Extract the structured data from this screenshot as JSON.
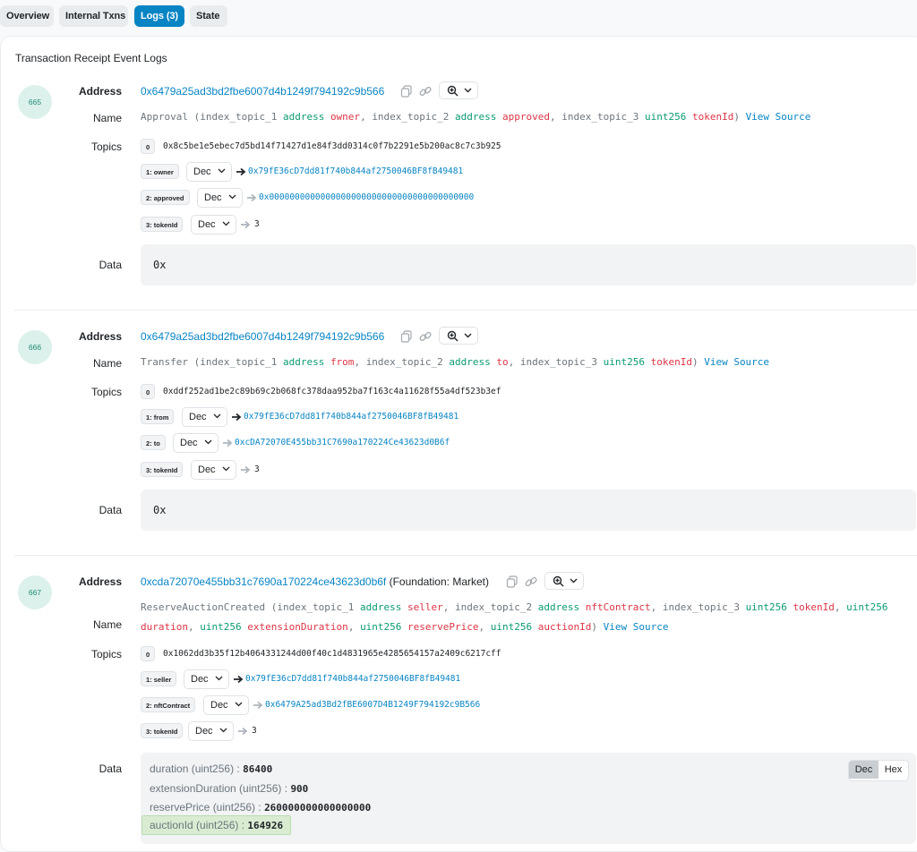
{
  "tabs": [
    {
      "label": "Overview",
      "active": false
    },
    {
      "label": "Internal Txns",
      "active": false
    },
    {
      "label": "Logs (3)",
      "active": true
    },
    {
      "label": "State",
      "active": false
    }
  ],
  "section_title": "Transaction Receipt Event Logs",
  "labels": {
    "address": "Address",
    "name": "Name",
    "topics": "Topics",
    "data": "Data"
  },
  "view_source": "View Source",
  "logs": [
    {
      "index": "665",
      "address": "0x6479a25ad3bd2fbe6007d4b1249f794192c9b566",
      "event": "Approval",
      "params": [
        {
          "topic": "index_topic_1",
          "type": "address",
          "name": "owner"
        },
        {
          "topic": "index_topic_2",
          "type": "address",
          "name": "approved"
        },
        {
          "topic": "index_topic_3",
          "type": "uint256",
          "name": "tokenId"
        }
      ],
      "topic0": "0x8c5be1e5ebec7d5bd14f71427d1e84f3dd0314c0f7b2291e5b200ac8c7c3b925",
      "topics": [
        {
          "label": "1: owner",
          "format": "Dec",
          "value": "0x79fE36cD7dd81f740b844af2750046BF8fB49481",
          "link": true
        },
        {
          "label": "2: approved",
          "format": "Dec",
          "value": "0x0000000000000000000000000000000000000000",
          "link": true
        },
        {
          "label": "3: tokenId",
          "format": "Dec",
          "value": "3",
          "link": false
        }
      ],
      "data": "0x"
    },
    {
      "index": "666",
      "address": "0x6479a25ad3bd2fbe6007d4b1249f794192c9b566",
      "event": "Transfer",
      "params": [
        {
          "topic": "index_topic_1",
          "type": "address",
          "name": "from"
        },
        {
          "topic": "index_topic_2",
          "type": "address",
          "name": "to"
        },
        {
          "topic": "index_topic_3",
          "type": "uint256",
          "name": "tokenId"
        }
      ],
      "topic0": "0xddf252ad1be2c89b69c2b068fc378daa952ba7f163c4a11628f55a4df523b3ef",
      "topics": [
        {
          "label": "1: from",
          "format": "Dec",
          "value": "0x79fE36cD7dd81f740b844af2750046BF8fB49481",
          "link": true
        },
        {
          "label": "2: to",
          "format": "Dec",
          "value": "0xcDA72070E455bb31C7690a170224Ce43623d0B6f",
          "link": true
        },
        {
          "label": "3: tokenId",
          "format": "Dec",
          "value": "3",
          "link": false
        }
      ],
      "data": "0x"
    },
    {
      "index": "667",
      "address": "0xcda72070e455bb31c7690a170224ce43623d0b6f",
      "address_tag": "(Foundation: Market)",
      "event": "ReserveAuctionCreated",
      "params": [
        {
          "topic": "index_topic_1",
          "type": "address",
          "name": "seller"
        },
        {
          "topic": "index_topic_2",
          "type": "address",
          "name": "nftContract"
        },
        {
          "topic": "index_topic_3",
          "type": "uint256",
          "name": "tokenId"
        },
        {
          "topic": "",
          "type": "uint256",
          "name": "duration"
        },
        {
          "topic": "",
          "type": "uint256",
          "name": "extensionDuration"
        },
        {
          "topic": "",
          "type": "uint256",
          "name": "reservePrice"
        },
        {
          "topic": "",
          "type": "uint256",
          "name": "auctionId"
        }
      ],
      "topic0": "0x1062dd3b35f12b4064331244d00f40c1d4831965e4285654157a2409c6217cff",
      "topics": [
        {
          "label": "1: seller",
          "format": "Dec",
          "value": "0x79fE36cD7dd81f740b844af2750046BF8fB49481",
          "link": true
        },
        {
          "label": "2: nftContract",
          "format": "Dec",
          "value": "0x6479A25ad3Bd2fBE6007D4B1249F794192c9B566",
          "link": true
        },
        {
          "label": "3: tokenId",
          "format": "Dec",
          "value": "3",
          "link": false
        }
      ],
      "data_rows": [
        {
          "label": "duration (uint256) :",
          "value": "86400"
        },
        {
          "label": "extensionDuration (uint256) :",
          "value": "900"
        },
        {
          "label": "reservePrice (uint256) :",
          "value": "260000000000000000"
        },
        {
          "label": "auctionId (uint256) :",
          "value": "164926",
          "highlight": true
        }
      ],
      "toggle": {
        "dec": "Dec",
        "hex": "Hex",
        "selected": "Dec"
      }
    }
  ],
  "icons": [
    "copy-icon",
    "link-icon",
    "zoom-icon",
    "chevron-down-icon",
    "arrow-right-icon"
  ],
  "colors": {
    "link": "#0784c3",
    "keyword": "#0b9a74",
    "param": "#dc3545",
    "badge_bg": "#dcf1ec",
    "active_tab": "#0784c3"
  }
}
